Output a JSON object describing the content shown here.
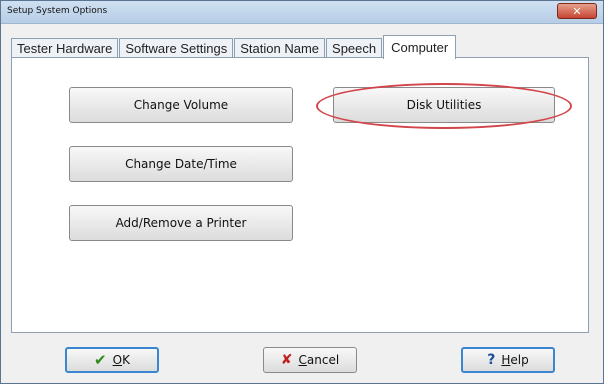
{
  "window": {
    "title": "Setup System Options",
    "close_glyph": "✕"
  },
  "tabs": [
    {
      "label": "Tester Hardware"
    },
    {
      "label": "Software Settings"
    },
    {
      "label": "Station Name"
    },
    {
      "label": "Speech"
    },
    {
      "label": "Computer",
      "active": true
    }
  ],
  "buttons": {
    "change_volume": "Change Volume",
    "disk_utilities": "Disk Utilities",
    "change_date_time": "Change Date/Time",
    "add_remove_printer": "Add/Remove a Printer"
  },
  "footer": {
    "ok": {
      "icon": "checkmark-icon",
      "glyph": "✔",
      "mnemonic": "O",
      "rest": "K"
    },
    "cancel": {
      "icon": "x-icon",
      "glyph": "✘",
      "mnemonic": "C",
      "rest": "ancel"
    },
    "help": {
      "icon": "question-icon",
      "glyph": "?",
      "mnemonic": "H",
      "rest": "elp"
    }
  },
  "colors": {
    "highlight_ring": "#d2454a",
    "close_button": "#c54431",
    "ok_check": "#2f8a17",
    "cancel_x": "#c02020"
  }
}
